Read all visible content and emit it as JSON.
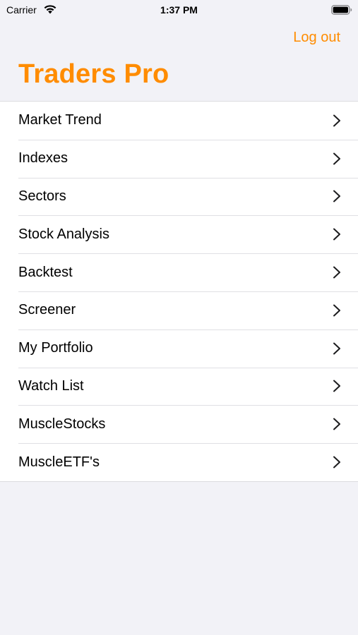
{
  "status_bar": {
    "carrier": "Carrier",
    "time": "1:37 PM",
    "icons": [
      "wifi-icon",
      "battery-icon"
    ]
  },
  "nav": {
    "logout_label": "Log out",
    "title": "Traders Pro"
  },
  "menu": {
    "items": [
      {
        "label": "Market Trend"
      },
      {
        "label": "Indexes"
      },
      {
        "label": "Sectors"
      },
      {
        "label": "Stock Analysis"
      },
      {
        "label": "Backtest"
      },
      {
        "label": "Screener"
      },
      {
        "label": "My Portfolio"
      },
      {
        "label": "Watch List"
      },
      {
        "label": "MuscleStocks"
      },
      {
        "label": "MuscleETF's"
      }
    ],
    "chevron_icon": "chevron-right-icon"
  },
  "colors": {
    "accent": "#ff8c00",
    "background": "#f2f2f7",
    "list_background": "#ffffff",
    "separator": "#e0e0e4"
  }
}
